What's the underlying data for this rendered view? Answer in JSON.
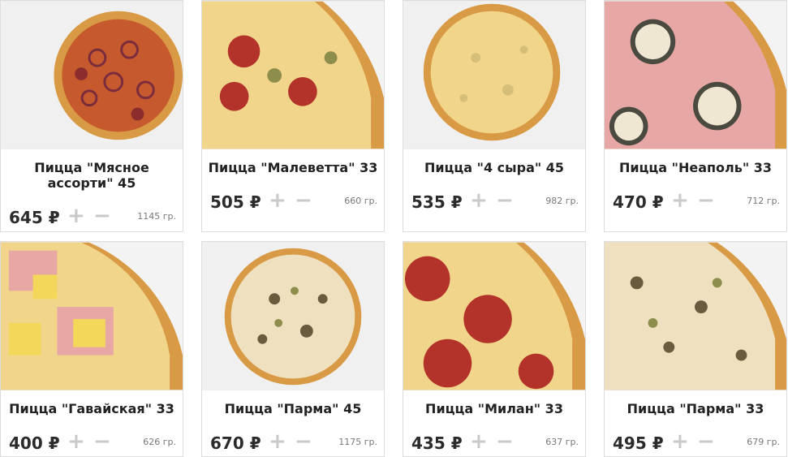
{
  "products": [
    {
      "title": "Пицца \"Мясное ассорти\" 45",
      "price": "645 ₽",
      "weight": "1145 гр.",
      "plus": "+",
      "minus": "−"
    },
    {
      "title": "Пицца \"Малеветта\" 33",
      "price": "505 ₽",
      "weight": "660 гр.",
      "plus": "+",
      "minus": "−"
    },
    {
      "title": "Пицца \"4 сыра\" 45",
      "price": "535 ₽",
      "weight": "982 гр.",
      "plus": "+",
      "minus": "−"
    },
    {
      "title": "Пицца \"Неаполь\" 33",
      "price": "470 ₽",
      "weight": "712 гр.",
      "plus": "+",
      "minus": "−"
    },
    {
      "title": "Пицца \"Гавайская\" 33",
      "price": "400 ₽",
      "weight": "626 гр.",
      "plus": "+",
      "minus": "−"
    },
    {
      "title": "Пицца \"Парма\" 45",
      "price": "670 ₽",
      "weight": "1175 гр.",
      "plus": "+",
      "minus": "−"
    },
    {
      "title": "Пицца \"Милан\" 33",
      "price": "435 ₽",
      "weight": "637 гр.",
      "plus": "+",
      "minus": "−"
    },
    {
      "title": "Пицца \"Парма\" 33",
      "price": "495 ₽",
      "weight": "679 гр.",
      "plus": "+",
      "minus": "−"
    }
  ],
  "colors": {
    "crust": "#d89a45",
    "cheese": "#f1d58a",
    "salami": "#b3322a",
    "ham": "#e7a7a5",
    "pineapple": "#f3d75a",
    "eggplant": "#4a4a40"
  }
}
